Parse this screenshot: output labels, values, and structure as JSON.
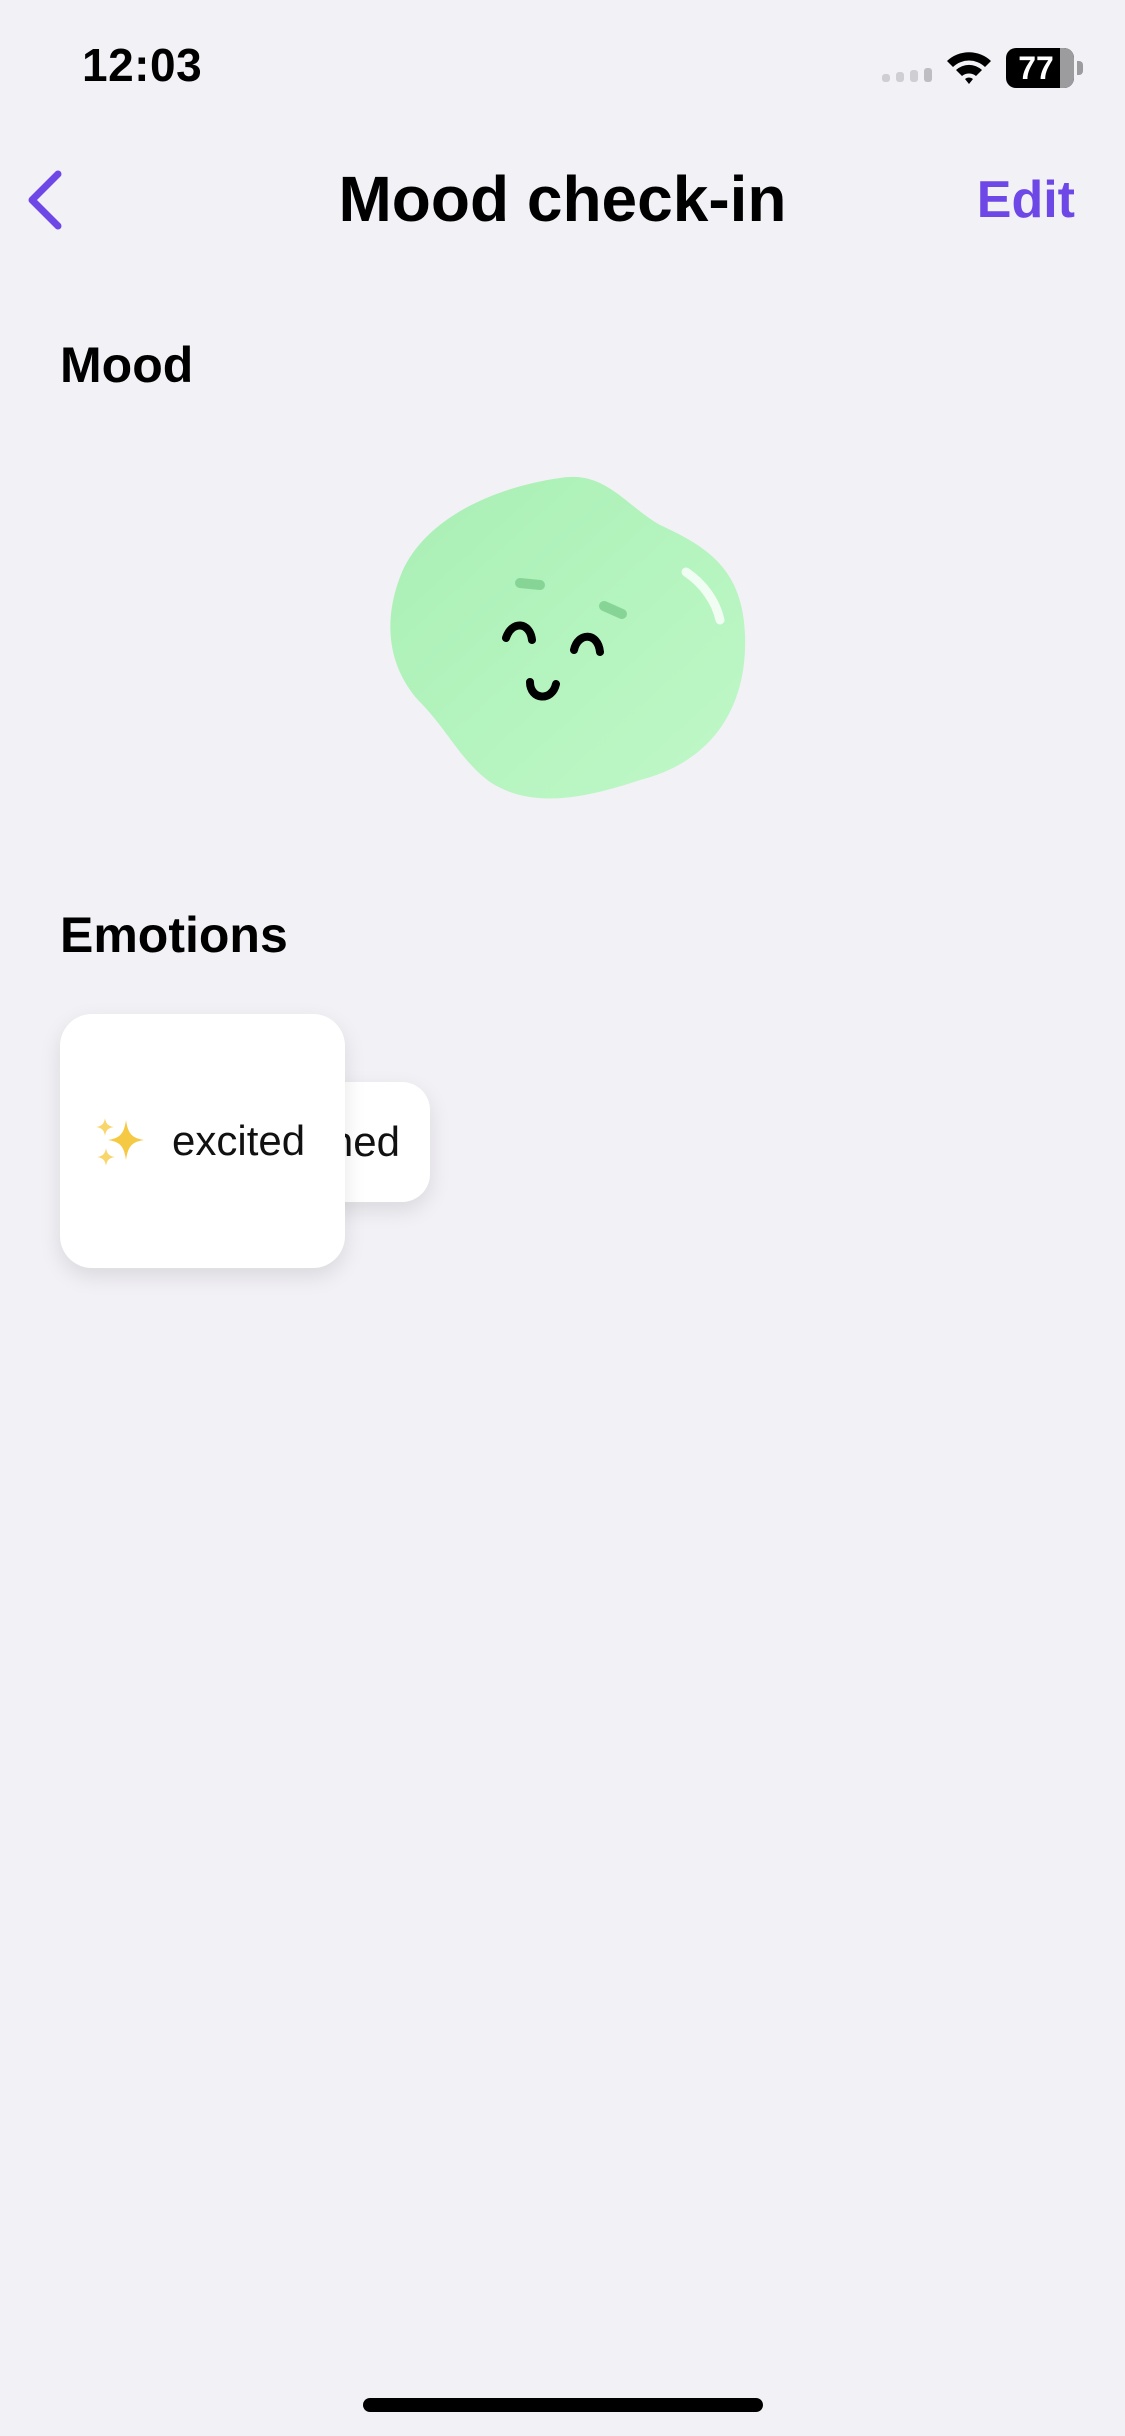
{
  "status_bar": {
    "time": "12:03",
    "battery_level": "77",
    "icons": [
      "signal-icon",
      "wifi-icon",
      "battery-icon"
    ]
  },
  "nav": {
    "back_icon": "chevron-left-icon",
    "title": "Mood check-in",
    "edit_label": "Edit"
  },
  "mood": {
    "heading": "Mood",
    "illustration": "smiling-green-blob",
    "color": "#B3F5BE"
  },
  "emotions": {
    "heading": "Emotions",
    "items": [
      {
        "emoji": "sparkles-icon",
        "label": "excited"
      },
      {
        "label": "ned"
      }
    ]
  },
  "colors": {
    "accent": "#6E48E6",
    "background": "#F2F1F6"
  }
}
